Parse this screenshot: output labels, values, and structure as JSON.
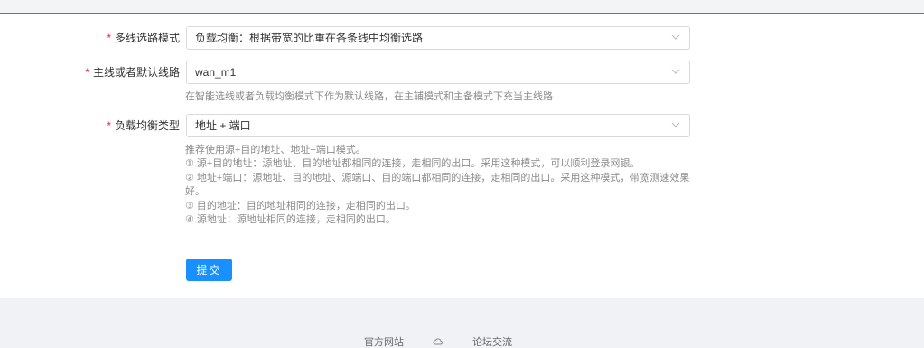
{
  "form": {
    "fields": [
      {
        "label": "多线选路模式",
        "value": "负载均衡：根据带宽的比重在各条线中均衡选路"
      },
      {
        "label": "主线或者默认线路",
        "value": "wan_m1",
        "help": "在智能选线或者负载均衡模式下作为默认线路，在主辅模式和主备模式下充当主线路"
      },
      {
        "label": "负载均衡类型",
        "value": "地址 + 端口"
      }
    ],
    "required_mark": "*",
    "lb_help": [
      "推荐使用源+目的地址、地址+端口模式。",
      "① 源+目的地址：源地址、目的地址都相同的连接，走相同的出口。采用这种模式，可以顺利登录网银。",
      "② 地址+端口：源地址、目的地址、源端口、目的端口都相同的连接，走相同的出口。采用这种模式，带宽测速效果好。",
      "③ 目的地址：目的地址相同的连接，走相同的出口。",
      "④ 源地址：源地址相同的连接，走相同的出口。"
    ],
    "submit_label": "提交"
  },
  "footer": {
    "links": [
      "官方网站",
      "论坛交流"
    ],
    "icon": "cloud-icon"
  },
  "colors": {
    "accent": "#1890ff",
    "top_border": "#1e88e5",
    "required": "#f5222d"
  }
}
